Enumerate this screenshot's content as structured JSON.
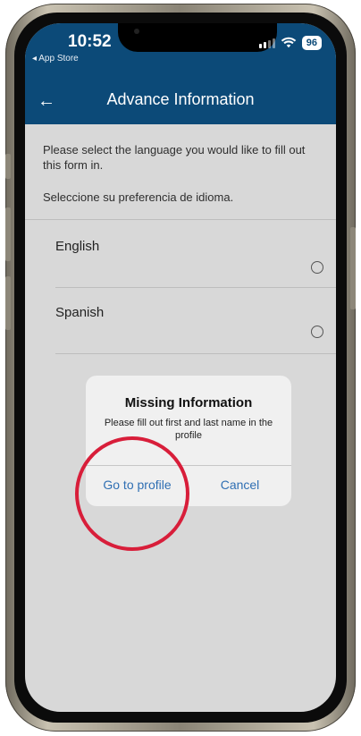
{
  "status_bar": {
    "time": "10:52",
    "back_app": "◂ App Store",
    "battery": "96"
  },
  "header": {
    "title": "Advance Information",
    "back_icon": "arrow-left-icon",
    "background_color": "#0c4a78"
  },
  "content": {
    "instruction_en": "Please select the language you would like to fill out this form in.",
    "instruction_es": "Seleccione su preferencia de idioma.",
    "options": [
      {
        "label": "English"
      },
      {
        "label": "Spanish"
      }
    ]
  },
  "dialog": {
    "title": "Missing Information",
    "message": "Please fill out first and last name in the profile",
    "primary_button": "Go to profile",
    "secondary_button": "Cancel",
    "button_color": "#2f6fb3",
    "highlight_color": "#d81e3a"
  }
}
